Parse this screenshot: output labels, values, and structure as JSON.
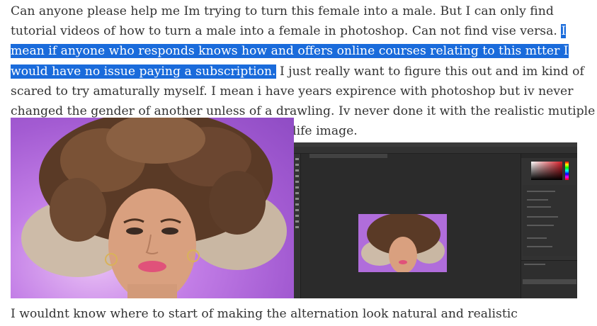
{
  "post": {
    "lines_before_highlight": "Can anyone please help me Im trying to turn this female into a male. But I can only find tutorial videos of how to turn a male into a female in photoshop. Can not find vise versa. ",
    "highlighted": "I mean if anyone who responds knows how and offers online courses relating to this mtter I would have no issue paying a subscription.",
    "after_highlight": " I just really want to figure this out and im kind of scared to try amaturally myself. I mean i have years expirence with photoshop but iv never changed the gender of another unless of a drawling. Iv never done it with the realistic mutiple color hue pixels that comes with doing a real life image.",
    "caption": "I wouldnt know where to start of making the alternation look natural and realistic"
  },
  "colors": {
    "highlight": "#1a6bdb",
    "text": "#333333",
    "ps_background": "#2b2b2b"
  },
  "images": {
    "portrait": "portrait-photo",
    "photoshop": "photoshop-screenshot"
  }
}
